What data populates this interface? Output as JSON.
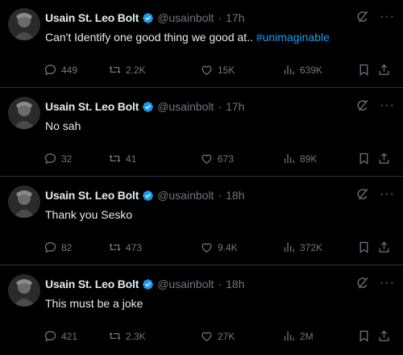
{
  "tweets": [
    {
      "name": "Usain St. Leo Bolt",
      "handle": "@usainbolt",
      "dot": "·",
      "time": "17h",
      "text": "Can't Identify one good thing we good at.. ",
      "hashtag": "#unimaginable",
      "replies": "449",
      "retweets": "2.2K",
      "likes": "15K",
      "views": "639K"
    },
    {
      "name": "Usain St. Leo Bolt",
      "handle": "@usainbolt",
      "dot": "·",
      "time": "17h",
      "text": "No sah",
      "hashtag": "",
      "replies": "32",
      "retweets": "41",
      "likes": "673",
      "views": "89K"
    },
    {
      "name": "Usain St. Leo Bolt",
      "handle": "@usainbolt",
      "dot": "·",
      "time": "18h",
      "text": "Thank you Sesko",
      "hashtag": "",
      "replies": "82",
      "retweets": "473",
      "likes": "9.4K",
      "views": "372K"
    },
    {
      "name": "Usain St. Leo Bolt",
      "handle": "@usainbolt",
      "dot": "·",
      "time": "18h",
      "text": "This must be a joke",
      "hashtag": "",
      "replies": "421",
      "retweets": "2.3K",
      "likes": "27K",
      "views": "2M"
    }
  ],
  "icons": {
    "verified": "verified-badge-icon",
    "grok": "grok-icon",
    "more": "more-icon",
    "reply": "reply-icon",
    "retweet": "retweet-icon",
    "like": "heart-icon",
    "views": "views-icon",
    "bookmark": "bookmark-icon",
    "share": "share-icon"
  },
  "more_glyph": "···",
  "colors": {
    "background": "#000000",
    "text": "#e7e9ea",
    "muted": "#71767b",
    "link": "#1d9bf0",
    "verified": "#1d9bf0",
    "divider": "#2f3336"
  }
}
